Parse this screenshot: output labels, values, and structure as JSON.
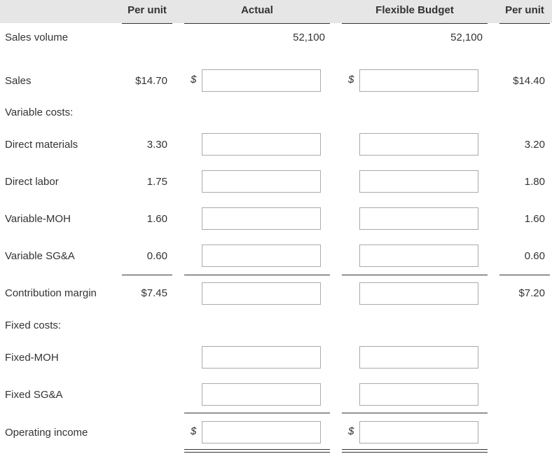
{
  "headers": {
    "per_unit_left": "Per unit",
    "actual": "Actual",
    "flexible_budget": "Flexible Budget",
    "per_unit_right": "Per unit"
  },
  "currency_symbol": "$",
  "rows": {
    "sales_volume": {
      "label": "Sales volume",
      "actual": "52,100",
      "flexible_budget": "52,100"
    },
    "sales": {
      "label": "Sales",
      "per_unit_left": "$14.70",
      "per_unit_right": "$14.40"
    },
    "variable_costs": {
      "label": "Variable costs:"
    },
    "direct_materials": {
      "label": "Direct materials",
      "per_unit_left": "3.30",
      "per_unit_right": "3.20"
    },
    "direct_labor": {
      "label": "Direct labor",
      "per_unit_left": "1.75",
      "per_unit_right": "1.80"
    },
    "variable_moh": {
      "label": "Variable-MOH",
      "per_unit_left": "1.60",
      "per_unit_right": "1.60"
    },
    "variable_sga": {
      "label": "Variable SG&A",
      "per_unit_left": "0.60",
      "per_unit_right": "0.60"
    },
    "contribution_margin": {
      "label": "Contribution margin",
      "per_unit_left": "$7.45",
      "per_unit_right": "$7.20"
    },
    "fixed_costs": {
      "label": "Fixed costs:"
    },
    "fixed_moh": {
      "label": "Fixed-MOH"
    },
    "fixed_sga": {
      "label": "Fixed SG&A"
    },
    "operating_income": {
      "label": "Operating income"
    }
  }
}
